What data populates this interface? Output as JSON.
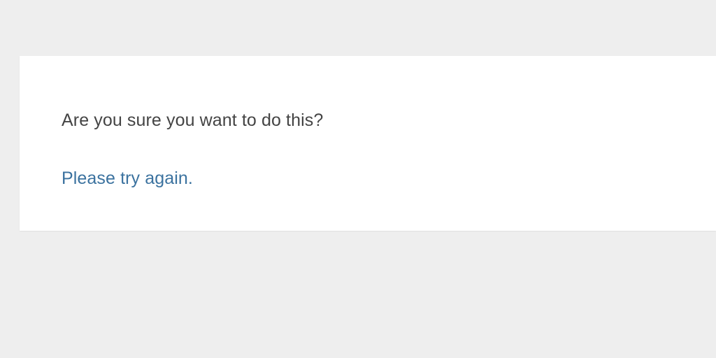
{
  "dialog": {
    "message": "Are you sure you want to do this?",
    "retry_label": "Please try again."
  }
}
